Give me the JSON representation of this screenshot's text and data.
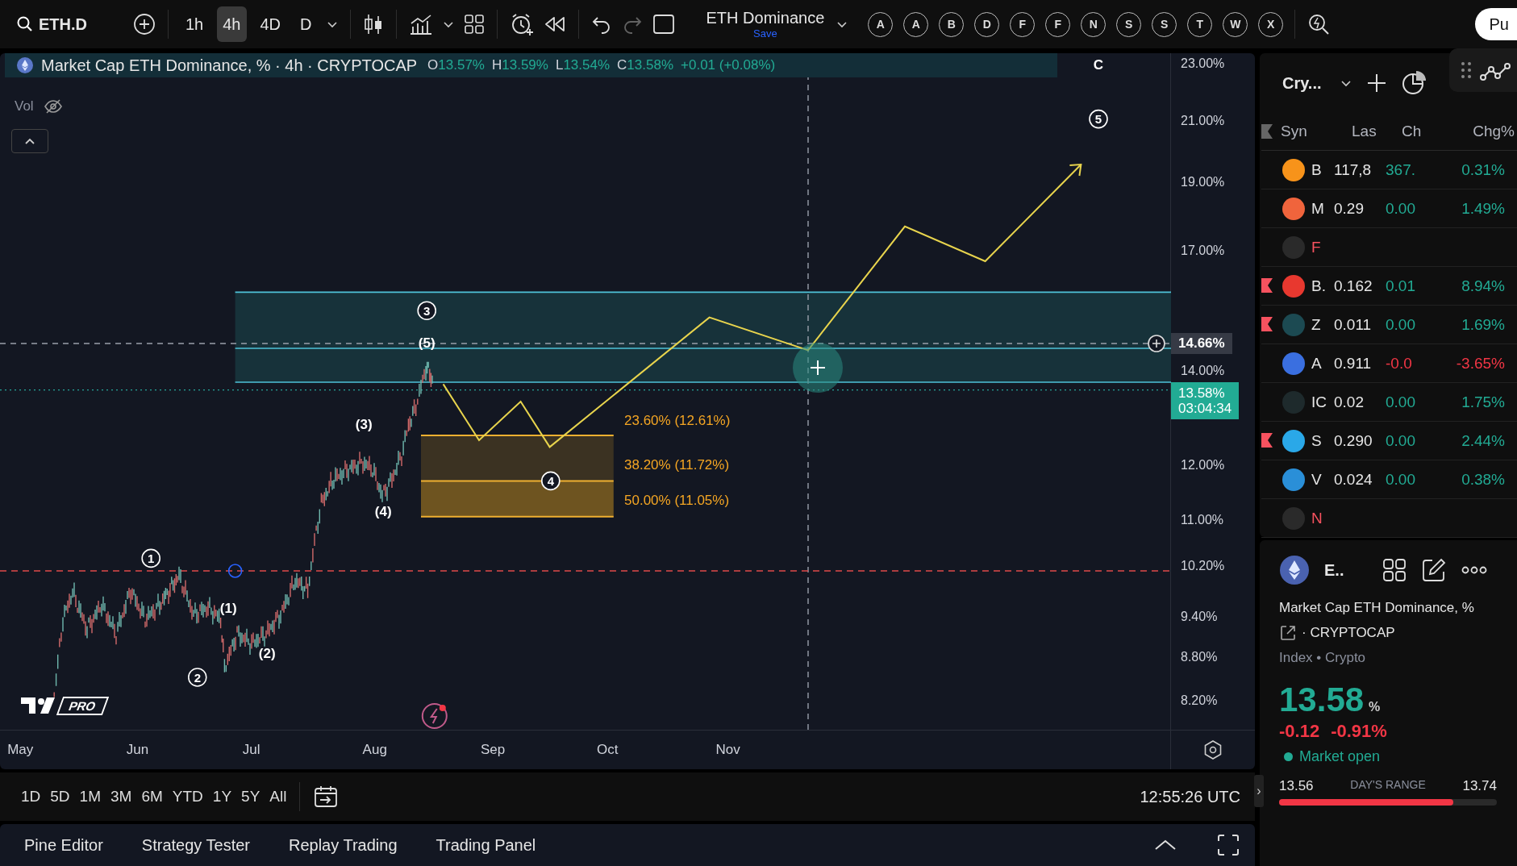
{
  "toolbar": {
    "symbol": "ETH.D",
    "intervals": [
      {
        "label": "1h",
        "selected": false
      },
      {
        "label": "4h",
        "selected": true
      },
      {
        "label": "4D",
        "selected": false
      },
      {
        "label": "D",
        "selected": false
      }
    ],
    "layout_name": "ETH Dominance",
    "save_label": "Save",
    "favorite_letters": [
      "A",
      "A",
      "B",
      "D",
      "F",
      "F",
      "N",
      "S",
      "S",
      "T",
      "W",
      "X"
    ],
    "publish_label": "Pu"
  },
  "chart": {
    "legend": {
      "title": "Market Cap ETH Dominance, % · 4h · CRYPTOCAP",
      "ohlc": [
        {
          "key": "O",
          "value": "13.57%"
        },
        {
          "key": "H",
          "value": "13.59%"
        },
        {
          "key": "L",
          "value": "13.54%"
        },
        {
          "key": "C",
          "value": "13.58%"
        }
      ],
      "change": "+0.01 (+0.08%)",
      "volume_label": "Vol"
    },
    "wave_labels": [
      {
        "kind": "plain",
        "text": "C"
      },
      {
        "kind": "circled",
        "text": "5"
      },
      {
        "kind": "circled",
        "text": "3"
      },
      {
        "kind": "plain",
        "text": "(5)"
      },
      {
        "kind": "plain",
        "text": "(3)"
      },
      {
        "kind": "plain",
        "text": "(4)"
      },
      {
        "kind": "circled",
        "text": "4"
      },
      {
        "kind": "circled",
        "text": "1"
      },
      {
        "kind": "plain",
        "text": "(1)"
      },
      {
        "kind": "circled",
        "text": "2"
      },
      {
        "kind": "plain",
        "text": "(2)"
      }
    ],
    "fib_levels": [
      "23.60% (12.61%)",
      "38.20% (11.72%)",
      "50.00% (11.05%)"
    ],
    "price_axis": [
      "23.00%",
      "21.00%",
      "19.00%",
      "17.00%",
      "14.00%",
      "12.00%",
      "11.00%",
      "10.20%",
      "9.40%",
      "8.80%",
      "8.20%"
    ],
    "crosshair_price": "14.66%",
    "last_price": "13.58%",
    "countdown": "03:04:34",
    "time_axis": [
      "May",
      "Jun",
      "Jul",
      "Aug",
      "Sep",
      "Oct",
      "Nov"
    ],
    "logo_badge": "PRO"
  },
  "range_bar": {
    "ranges": [
      "1D",
      "5D",
      "1M",
      "3M",
      "6M",
      "YTD",
      "1Y",
      "5Y",
      "All"
    ],
    "clock": "12:55:26 UTC"
  },
  "bottom_tabs": [
    "Pine Editor",
    "Strategy Tester",
    "Replay Trading",
    "Trading Panel"
  ],
  "panel_toggle": "›",
  "watchlist": {
    "list_name": "Cry...",
    "columns": [
      "Syn",
      "Las",
      "Ch",
      "Chg%"
    ],
    "rows": [
      {
        "kind": "symbol",
        "symbol": "B",
        "last": "117,8",
        "change": "367.",
        "change_pct": "0.31%",
        "negative": false,
        "flagged": false,
        "color": "#f7931a"
      },
      {
        "kind": "symbol",
        "symbol": "M",
        "last": "0.29",
        "change": "0.00",
        "change_pct": "1.49%",
        "negative": false,
        "flagged": false,
        "color": "#f0643c"
      },
      {
        "kind": "section",
        "symbol": "F"
      },
      {
        "kind": "symbol",
        "symbol": "B.",
        "last": "0.162",
        "change": "0.01",
        "change_pct": "8.94%",
        "negative": false,
        "flagged": true,
        "color": "#e8382f"
      },
      {
        "kind": "symbol",
        "symbol": "Z",
        "last": "0.011",
        "change": "0.00",
        "change_pct": "1.69%",
        "negative": false,
        "flagged": true,
        "color": "#1c4a52"
      },
      {
        "kind": "symbol",
        "symbol": "A",
        "last": "0.911",
        "change": "-0.0",
        "change_pct": "-3.65%",
        "negative": true,
        "flagged": false,
        "color": "#3a6fe0"
      },
      {
        "kind": "symbol",
        "symbol": "IC",
        "last": "0.02",
        "change": "0.00",
        "change_pct": "1.75%",
        "negative": false,
        "flagged": false,
        "color": "#1e2a2c"
      },
      {
        "kind": "symbol",
        "symbol": "S",
        "last": "0.290",
        "change": "0.00",
        "change_pct": "2.44%",
        "negative": false,
        "flagged": true,
        "color": "#2aa8e8"
      },
      {
        "kind": "symbol",
        "symbol": "V",
        "last": "0.024",
        "change": "0.00",
        "change_pct": "0.38%",
        "negative": false,
        "flagged": false,
        "color": "#2a8fd8"
      },
      {
        "kind": "section",
        "symbol": "N"
      }
    ]
  },
  "details": {
    "short_name": "E..",
    "name": "Market Cap ETH Dominance, %",
    "exchange": "· CRYPTOCAP",
    "category": "Index • Crypto",
    "price": "13.58",
    "unit": "%",
    "change": "-0.12",
    "change_pct": "-0.91%",
    "negative": true,
    "market_status": "Market open",
    "market_open": true,
    "range_low": "13.56",
    "range_label": "DAY'S RANGE",
    "range_high": "13.74",
    "level": 0.8
  }
}
